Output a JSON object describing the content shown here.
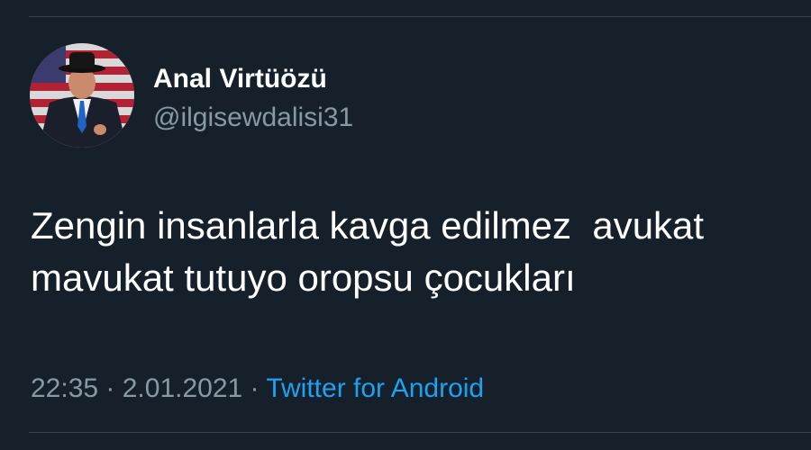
{
  "tweet": {
    "author": {
      "display_name": "Anal Virtüözü",
      "handle": "@ilgisewdalisi31",
      "avatar_icon": "profile-photo"
    },
    "text": "Zengin insanlarla kavga edilmez  avukat mavukat tutuyo oropsu çocukları",
    "time": "22:35",
    "separator": " · ",
    "date": "2.01.2021",
    "source": "Twitter for Android"
  },
  "colors": {
    "background": "#15202b",
    "primary_text": "#ffffff",
    "secondary_text": "#8899a6",
    "link": "#1da1f2",
    "divider": "#38444d"
  }
}
